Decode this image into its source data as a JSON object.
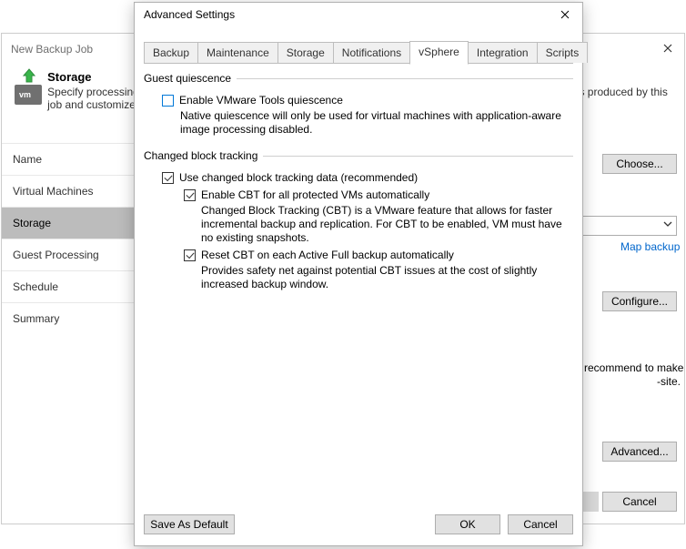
{
  "back": {
    "title": "New Backup Job",
    "close_icon": "close",
    "header": {
      "title": "Storage",
      "subtitle": "Specify processing proxy server to be used for source data retrieval, backup repository to store the backup files produced by this job and customize advanced job settings if required."
    },
    "nav": [
      "Name",
      "Virtual Machines",
      "Storage",
      "Guest Processing",
      "Schedule",
      "Summary"
    ],
    "nav_selected_index": 2,
    "right": {
      "choose": "Choose...",
      "map": "Map backup",
      "configure": "Configure...",
      "advanced": "Advanced...",
      "cancel": "Cancel",
      "extra_line1": "recommend to make",
      "extra_line2": "-site."
    }
  },
  "front": {
    "title": "Advanced Settings",
    "tabs": [
      "Backup",
      "Maintenance",
      "Storage",
      "Notifications",
      "vSphere",
      "Integration",
      "Scripts"
    ],
    "active_tab_index": 4,
    "guest": {
      "legend": "Guest quiescence",
      "enable_label": "Enable VMware Tools quiescence",
      "enable_checked": false,
      "enable_desc": "Native quiescence will only be used for virtual machines with application-aware image processing disabled."
    },
    "cbt": {
      "legend": "Changed block tracking",
      "use_label": "Use changed block tracking data (recommended)",
      "use_checked": true,
      "auto_label": "Enable CBT for all protected VMs automatically",
      "auto_checked": true,
      "auto_desc": "Changed Block Tracking (CBT) is a VMware feature that allows for faster incremental backup and replication. For CBT to be enabled, VM must have no existing snapshots.",
      "reset_label": "Reset CBT on each Active Full backup automatically",
      "reset_checked": true,
      "reset_desc": "Provides safety net against potential CBT issues at the cost of slightly increased backup window."
    },
    "footer": {
      "save": "Save As Default",
      "ok": "OK",
      "cancel": "Cancel"
    }
  }
}
